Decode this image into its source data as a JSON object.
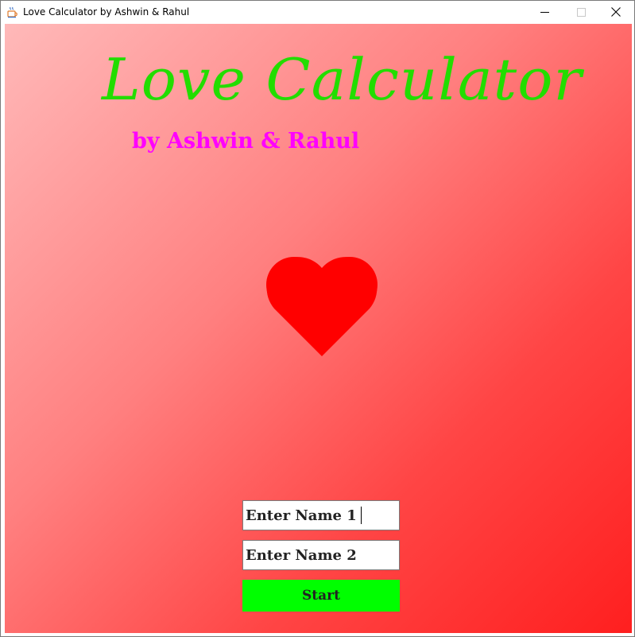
{
  "window": {
    "title": "Love Calculator by Ashwin & Rahul",
    "icon": "java-cup-icon",
    "controls": {
      "minimize_icon": "minimize-icon",
      "maximize_icon": "maximize-icon",
      "close_icon": "close-icon"
    }
  },
  "main": {
    "title": "Love Calculator",
    "subtitle": "by Ashwin & Rahul",
    "heart_icon": "heart-icon",
    "name1": {
      "value": "Enter Name 1",
      "focused": true
    },
    "name2": {
      "value": "Enter Name 2"
    },
    "start_label": "Start"
  },
  "colors": {
    "title": "#22dd00",
    "subtitle": "#ff00ff",
    "heart": "#ff0000",
    "start_button": "#00ff00",
    "background_start": "#ffb9b9",
    "background_end": "#ff1f1f"
  }
}
